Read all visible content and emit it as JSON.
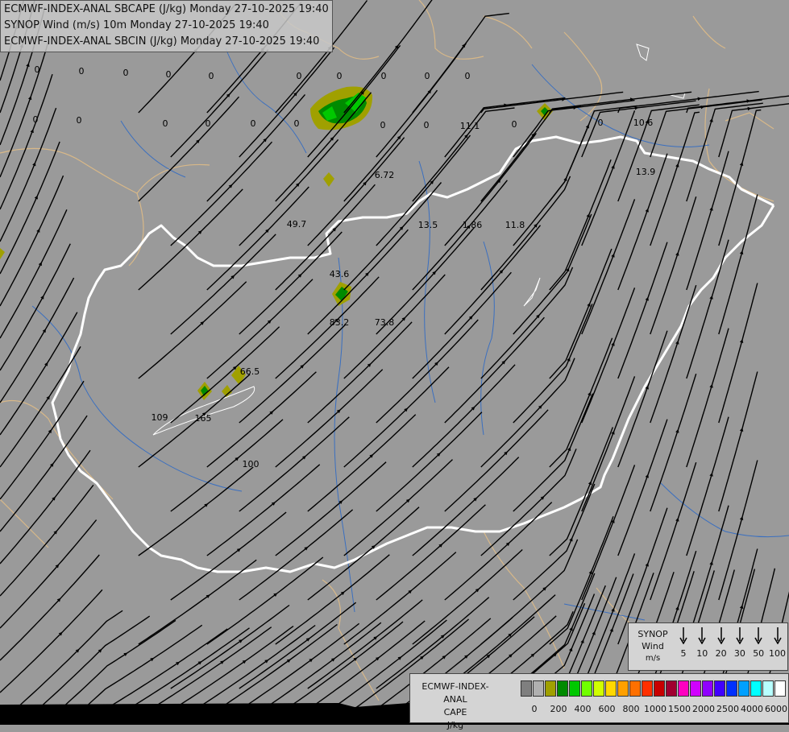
{
  "title_lines": [
    "ECMWF-INDEX-ANAL SBCAPE (J/kg) Monday 27-10-2025 19:40",
    "SYNOP Wind (m/s) 10m Monday 27-10-2025 19:40",
    "ECMWF-INDEX-ANAL SBCIN (J/kg) Monday 27-10-2025 19:40"
  ],
  "colors": {
    "background": "#9a9a9a",
    "border": "#ffffff",
    "streamline": "#000000",
    "river": "#3a6fc0",
    "region_border": "#d8b888"
  },
  "value_labels": [
    "0",
    "0",
    "0",
    "0",
    "0",
    "0",
    "0",
    "0",
    "0",
    "0",
    "0",
    "0",
    "0",
    "0",
    "0",
    "0",
    "0",
    "0",
    "0",
    "0",
    "11.1",
    "10.6",
    "13.9",
    "6.72",
    "49.7",
    "13.5",
    "1.86",
    "11.8",
    "43.6",
    "83.2",
    "73.8",
    "66.5",
    "109",
    "165",
    "100"
  ],
  "wind_legend": {
    "title": "SYNOP",
    "subtitle": "Wind",
    "unit": "m/s",
    "speeds": [
      "5",
      "10",
      "20",
      "30",
      "50",
      "100"
    ]
  },
  "cape_legend": {
    "title": "ECMWF-INDEX-ANAL",
    "subtitle": "CAPE",
    "unit": "J/kg",
    "colors": [
      "#7f7f7f",
      "#b0b0b0",
      "#a0a000",
      "#008a00",
      "#00c800",
      "#70ff00",
      "#d0ff00",
      "#ffd800",
      "#ffa000",
      "#ff7000",
      "#ff3000",
      "#c80000",
      "#a00030",
      "#ff00c0",
      "#d000ff",
      "#9000ff",
      "#4000ff",
      "#0030ff",
      "#00a0ff",
      "#00ffff",
      "#b8ffff",
      "#ffffff"
    ],
    "ticks": [
      "0",
      "200",
      "400",
      "600",
      "800",
      "1000",
      "1500",
      "2000",
      "2500",
      "4000",
      "6000"
    ]
  }
}
